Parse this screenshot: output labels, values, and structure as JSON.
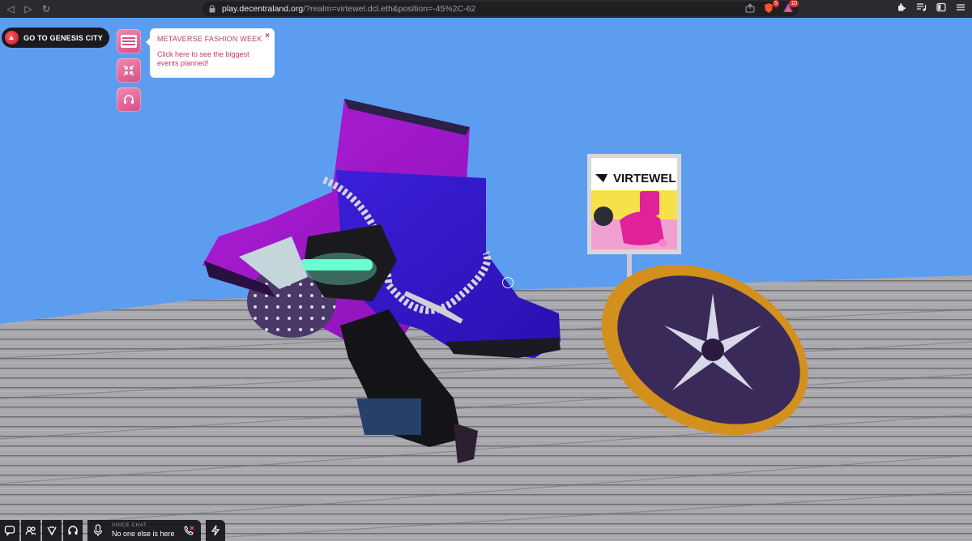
{
  "browser": {
    "url_host": "play.decentraland.org",
    "url_path": "/?realm=virtewel.dcl.eth&position=-45%2C-62",
    "extension_badges": [
      "5",
      "10"
    ]
  },
  "hud": {
    "genesis_button": "GO TO GENESIS CITY",
    "event_popup": {
      "title": "METAVERSE FASHION WEEK",
      "text": "Click here to see the biggest events planned!",
      "close": "×"
    }
  },
  "scene": {
    "billboard_brand": "VIRTEWEL"
  },
  "bottom_bar": {
    "voice_label": "VOICE CHAT",
    "voice_status": "No one else is here"
  },
  "colors": {
    "sky": "#5c9df0",
    "accent_pink": "#c23a6c",
    "hud_dark": "#1b1a20"
  }
}
